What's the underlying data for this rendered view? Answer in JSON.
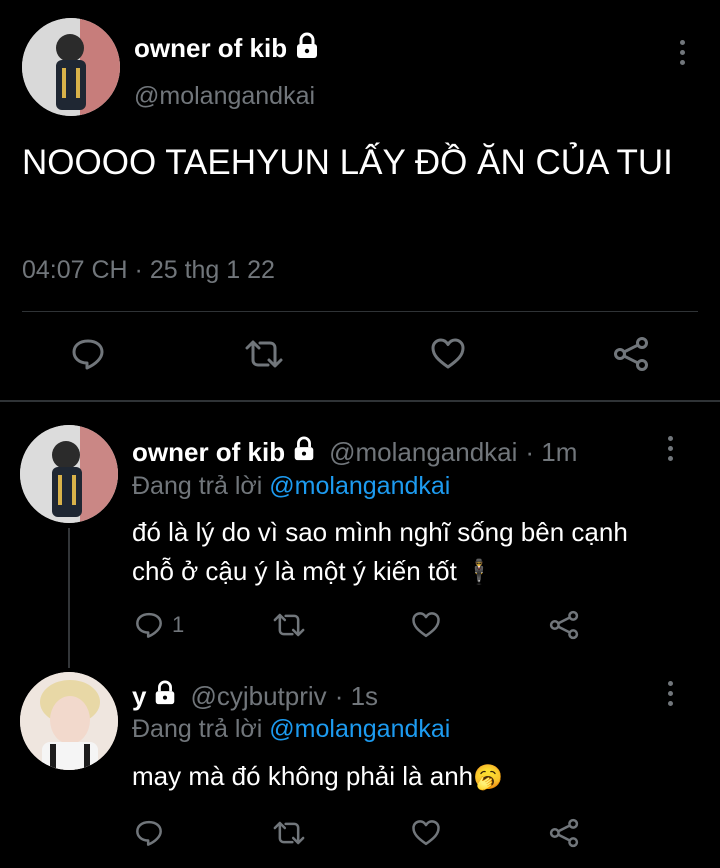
{
  "main_tweet": {
    "name": "owner of kib",
    "handle": "@molangandkai",
    "text": "NOOOO TAEHYUN LẤY ĐỒ ĂN CỦA TUI",
    "timestamp": "04:07 CH · 25 thg 1 22"
  },
  "replies": [
    {
      "name": "owner of kib",
      "handle": "@molangandkai",
      "age": "· 1m",
      "replying_prefix": "Đang trả lời",
      "replying_to": "@molangandkai",
      "text": "đó là lý do vì sao mình nghĩ sống bên cạnh chỗ ở cậu ý là một ý kiến tốt",
      "emoji": "🕴",
      "reply_count": "1"
    },
    {
      "name": "y",
      "handle": "@cyjbutpriv",
      "age": "· 1s",
      "replying_prefix": "Đang trả lời",
      "replying_to": "@molangandkai",
      "text": "may mà đó không phải là anh",
      "emoji": "🥱"
    }
  ],
  "colors": {
    "background": "#000000",
    "text": "#ffffff",
    "secondary": "#71767b",
    "link": "#1d9bf0",
    "divider": "#2f3336"
  },
  "icons": [
    "lock-icon",
    "more-icon",
    "reply-icon",
    "retweet-icon",
    "like-icon",
    "share-icon"
  ]
}
